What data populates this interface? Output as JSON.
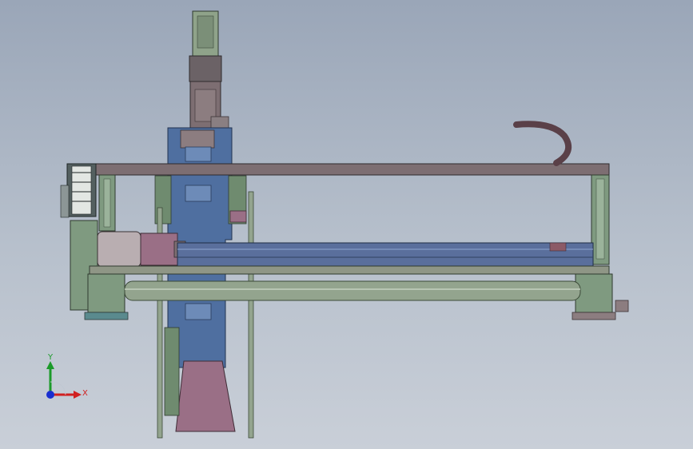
{
  "view": {
    "type": "cad-3d-viewport",
    "subject": "gantry-linear-axis-assembly",
    "colors": {
      "background_top": "#9aa6b8",
      "background_bottom": "#c9cfd8",
      "beam": "#7d6e72",
      "frame_green": "#7f9a80",
      "carriage_blue": "#4f6fa0",
      "rail_blue": "#5a6f9c",
      "pink_part": "#9a6f86",
      "rod_green": "#93a48e",
      "cable_chain": "#5a4048"
    }
  },
  "triad": {
    "y_label": "Y",
    "x_label": "X",
    "y_color": "#1c9a2a",
    "x_color": "#d02020",
    "z_color": "#1a2fd0"
  }
}
